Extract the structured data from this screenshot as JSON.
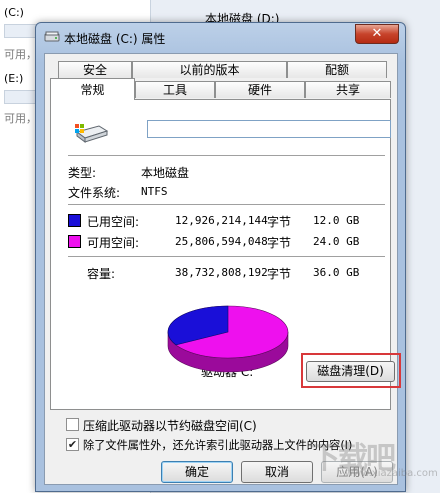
{
  "background": {
    "left_rows": [
      {
        "label": "(C:)",
        "sub": "可用，"
      },
      {
        "label": "(E:)",
        "sub": "可用，"
      }
    ],
    "right_title": "本地磁盘 (D:)"
  },
  "dialog": {
    "title": "本地磁盘 (C:) 属性",
    "close_label": "✕",
    "tabs_row1": [
      "安全",
      "以前的版本",
      "配额"
    ],
    "tabs_row2": [
      "常规",
      "工具",
      "硬件",
      "共享"
    ],
    "active_tab": "常规",
    "name_value": "",
    "type_label": "类型:",
    "type_value": "本地磁盘",
    "fs_label": "文件系统:",
    "fs_value": "NTFS",
    "used": {
      "label": "已用空间:",
      "bytes": "12,926,214,144",
      "unit": "字节",
      "size": "12.0 GB",
      "color": "#1a0fd8"
    },
    "free": {
      "label": "可用空间:",
      "bytes": "25,806,594,048",
      "unit": "字节",
      "size": "24.0 GB",
      "color": "#ee10ee"
    },
    "capacity": {
      "label": "容量:",
      "bytes": "38,732,808,192",
      "unit": "字节",
      "size": "36.0 GB"
    },
    "drive_label": "驱动器 C:",
    "cleanup_button": "磁盘清理(D)",
    "compress_label": "压缩此驱动器以节约磁盘空间(C)",
    "compress_checked": false,
    "index_label": "除了文件属性外，还允许索引此驱动器上文件的内容(I)",
    "index_checked": true,
    "ok_button": "确定",
    "cancel_button": "取消",
    "apply_button": "应用(A)"
  },
  "usage": {
    "used_fraction": 0.333
  },
  "watermark": {
    "text": "下载吧",
    "sub": "www.xiazaiba.com"
  }
}
